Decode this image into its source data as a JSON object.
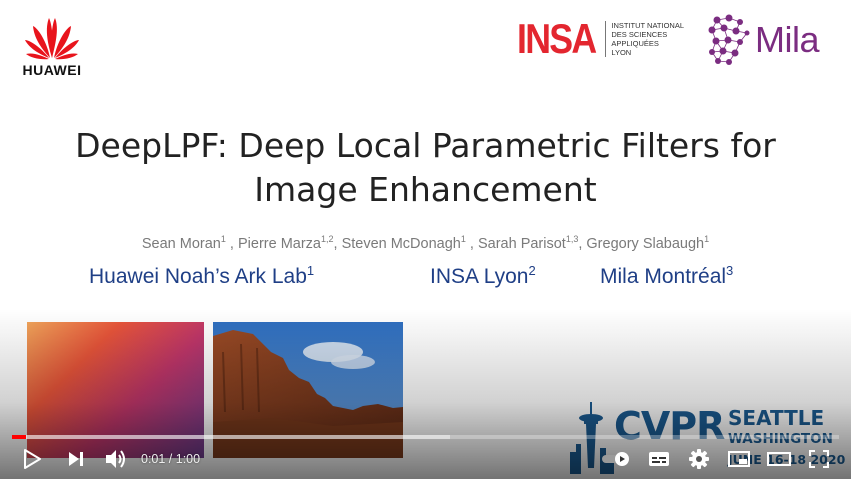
{
  "slide": {
    "title_line1": "DeepLPF: Deep Local Parametric Filters for",
    "title_line2": "Image Enhancement",
    "authors": [
      {
        "name": "Sean Moran",
        "sup": "1"
      },
      {
        "name": "Pierre Marza",
        "sup": "1,2"
      },
      {
        "name": "Steven McDonagh",
        "sup": "1"
      },
      {
        "name": "Sarah Parisot",
        "sup": "1,3"
      },
      {
        "name": "Gregory Slabaugh",
        "sup": "1"
      }
    ],
    "affiliations": [
      {
        "name": "Huawei Noah’s Ark Lab",
        "sup": "1"
      },
      {
        "name": "INSA Lyon",
        "sup": "2"
      },
      {
        "name": "Mila Montréal",
        "sup": "3"
      }
    ],
    "logos": {
      "huawei": "HUAWEI",
      "insa": "INSA",
      "insa_sub": [
        "INSTITUT NATIONAL",
        "DES SCIENCES",
        "APPLIQUÉES",
        "LYON"
      ],
      "mila": "Mila",
      "cvpr": "CVPR",
      "cvpr_city": "SEATTLE",
      "cvpr_state": "WASHINGTON",
      "cvpr_date": "JUNE 16-18 2020"
    },
    "colors": {
      "affiliation_blue": "#1f3f86",
      "insa_red": "#e3262f",
      "mila_purple": "#7b2d81",
      "huawei_red": "#e8141c",
      "cvpr_blue": "#1b5c93"
    }
  },
  "player": {
    "time_display": "0:01 / 1:00",
    "progress_played_fraction": 0.017,
    "progress_loaded_fraction": 0.53,
    "play_icon": "play-icon",
    "next_icon": "next-icon",
    "volume_icon": "volume-icon",
    "autoplay_icon": "autoplay-toggle-icon",
    "subtitles_icon": "subtitles-icon",
    "settings_icon": "gear-icon",
    "miniplayer_icon": "miniplayer-icon",
    "theater_icon": "theater-icon",
    "fullscreen_icon": "fullscreen-icon",
    "accent": "#ff0000"
  }
}
